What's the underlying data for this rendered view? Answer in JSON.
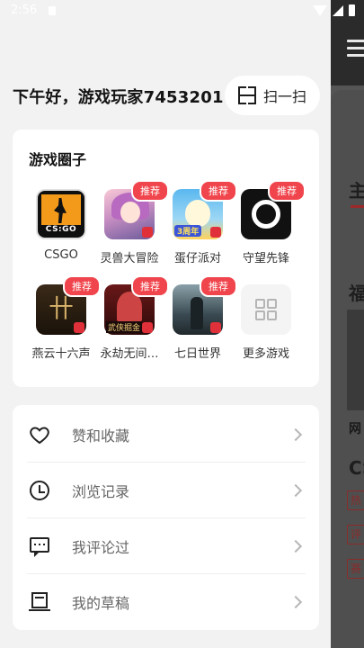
{
  "status_bar": {
    "time": "2:56"
  },
  "drawer": {
    "greeting": "下午好，游戏玩家7453201",
    "scan_label": "扫一扫",
    "games_section": {
      "title": "游戏圈子",
      "badge_label": "推荐",
      "games": [
        {
          "name": "CSGO",
          "icon": "csgo-icon",
          "recommended": false
        },
        {
          "name": "灵兽大冒险",
          "icon": "lingshou-icon",
          "recommended": true
        },
        {
          "name": "蛋仔派对",
          "icon": "danzai-icon",
          "recommended": true
        },
        {
          "name": "守望先锋",
          "icon": "overwatch-icon",
          "recommended": true
        },
        {
          "name": "燕云十六声",
          "icon": "yanyun-icon",
          "recommended": true
        },
        {
          "name": "永劫无间…",
          "icon": "yongjie-icon",
          "recommended": true
        },
        {
          "name": "七日世界",
          "icon": "qiri-icon",
          "recommended": true
        },
        {
          "name": "更多游戏",
          "icon": "more-games-icon",
          "recommended": false
        }
      ],
      "icon_texts": {
        "csgo": "CS:GO",
        "danzai": "3周年",
        "yongjie": "武侠掘金"
      }
    },
    "menu": [
      {
        "label": "赞和收藏",
        "icon": "heart-icon"
      },
      {
        "label": "浏览记录",
        "icon": "clock-icon"
      },
      {
        "label": "我评论过",
        "icon": "comment-icon"
      },
      {
        "label": "我的草稿",
        "icon": "draft-icon"
      }
    ]
  },
  "background_page": {
    "partial_texts": [
      "主",
      "福",
      "网",
      "CS",
      "热",
      "评",
      "赛"
    ]
  },
  "colors": {
    "badge": "#f0454c",
    "accent_underline": "#9c2a2a",
    "drawer_bg": "#f2f2f2"
  }
}
